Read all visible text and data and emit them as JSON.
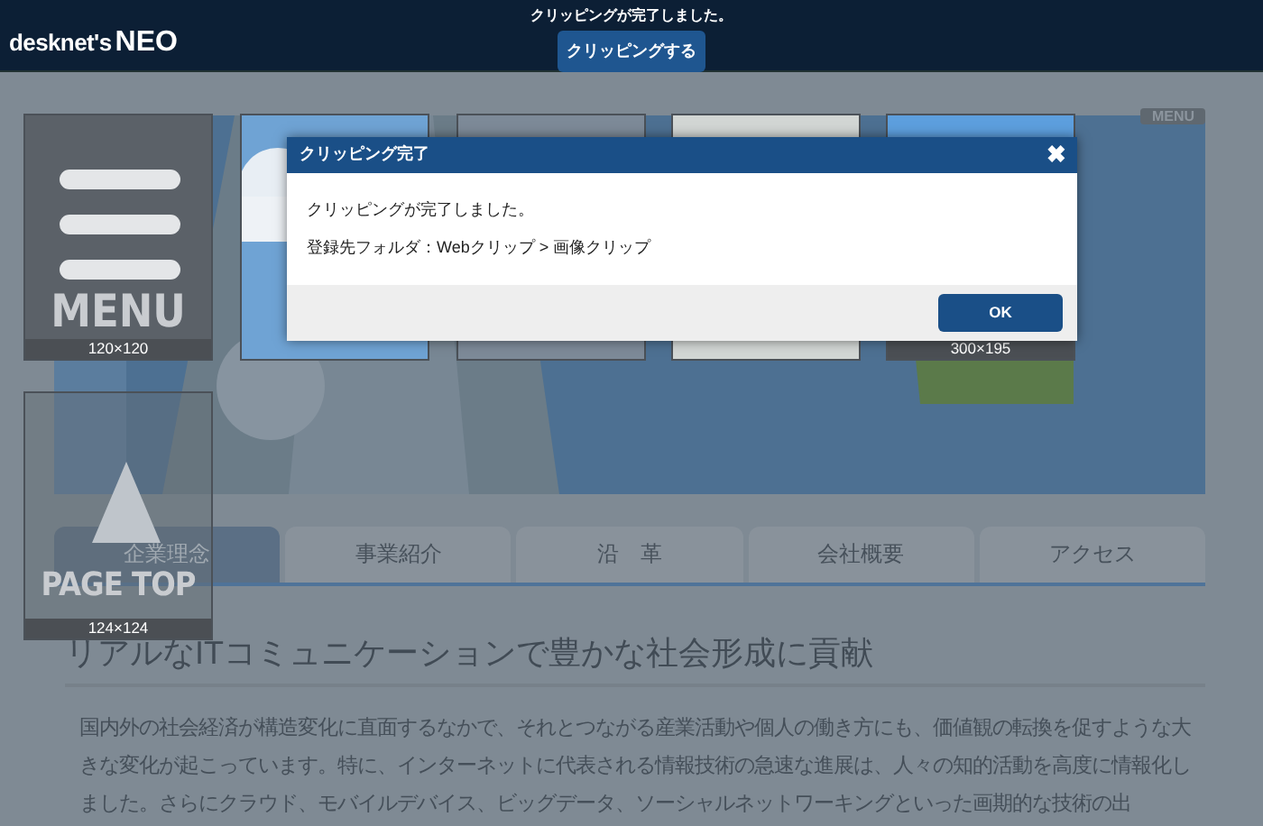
{
  "top_bar": {
    "logo_name": "desknet's",
    "logo_suffix": "NEO",
    "message": "クリッピングが完了しました。",
    "clip_button": "クリッピングする"
  },
  "page": {
    "menu_button": "MENU",
    "tabs": [
      {
        "label": "企業理念",
        "selected": true
      },
      {
        "label": "事業紹介",
        "selected": false
      },
      {
        "label": "沿　革",
        "selected": false
      },
      {
        "label": "会社概要",
        "selected": false
      },
      {
        "label": "アクセス",
        "selected": false
      }
    ],
    "heading": "リアルなITコミュニケーションで豊かな社会形成に貢献",
    "paragraph": "国内外の社会経済が構造変化に直面するなかで、それとつながる産業活動や個人の働き方にも、価値観の転換を促すような大きな変化が起こっています。特に、インターネットに代表される情報技術の急速な進展は、人々の知的活動を高度に情報化しました。さらにクラウド、モバイルデバイス、ビッグデータ、ソーシャルネットワーキングといった画期的な技術の出"
  },
  "tiles": [
    {
      "kind": "menu",
      "caption": "MENU",
      "size": "120×120"
    },
    {
      "kind": "picture"
    },
    {
      "kind": "picture"
    },
    {
      "kind": "picture"
    },
    {
      "kind": "picture",
      "size": "300×195"
    },
    {
      "kind": "pagetop",
      "caption": "PAGE TOP",
      "size": "124×124"
    }
  ],
  "dialog": {
    "title": "クリッピング完了",
    "close": "✖",
    "message": "クリッピングが完了しました。",
    "folder_label": "登録先フォルダ：",
    "folder_path": "Webクリップ > 画像クリップ",
    "ok_button": "OK"
  }
}
